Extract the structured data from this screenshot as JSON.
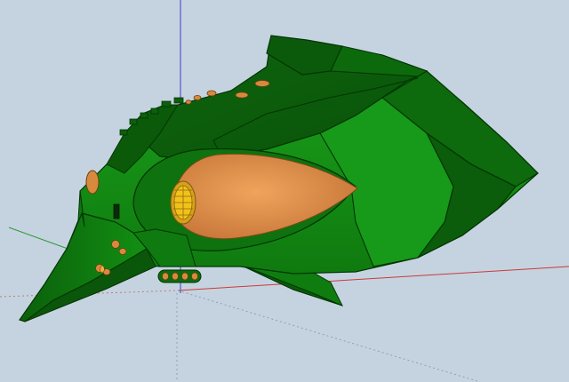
{
  "viewport": {
    "background_color": "#c5d3e0",
    "axes": {
      "blue_axis_color": "#3b3bd6",
      "red_axis_color": "#cc3a3a",
      "green_axis_color": "#2f9a3a",
      "dotted_axis_color": "#8aa0b8"
    }
  },
  "model": {
    "name": "green-spaceship-model",
    "colors": {
      "hull_dark": "#0b5a0b",
      "hull_mid": "#138a13",
      "hull_light": "#1fae1f",
      "hull_shadow": "#064306",
      "edge": "#033503",
      "intake_orange": "#e09048",
      "intake_orange_dark": "#b86a2a",
      "turbine_yellow": "#f2c21a",
      "port_orange": "#d88a3c"
    }
  }
}
